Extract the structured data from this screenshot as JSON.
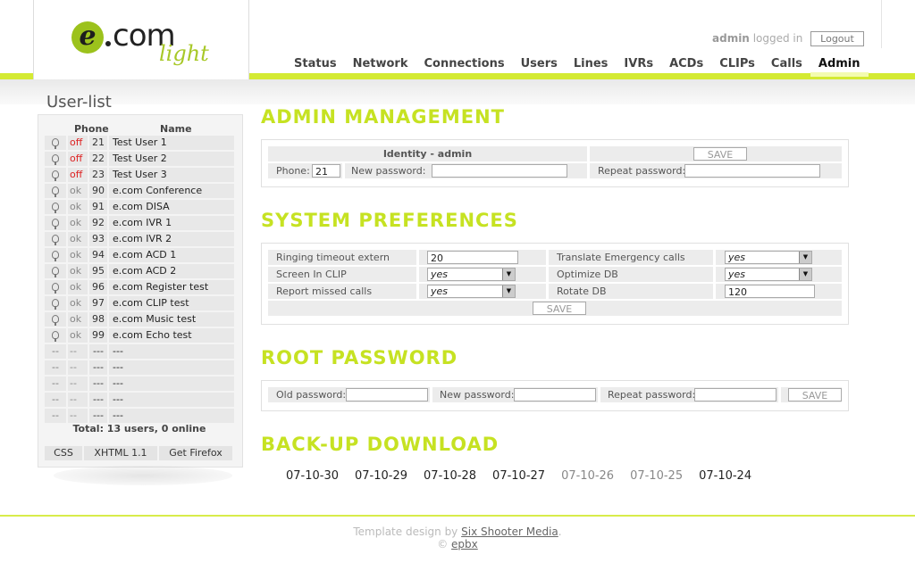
{
  "brand": {
    "logo_e": "e",
    "logo_com": "com",
    "logo_light": "light"
  },
  "login": {
    "user": "admin",
    "status": "logged in",
    "logout_label": "Logout"
  },
  "nav": [
    "Status",
    "Network",
    "Connections",
    "Users",
    "Lines",
    "IVRs",
    "ACDs",
    "CLIPs",
    "Calls",
    "Admin"
  ],
  "nav_active": "Admin",
  "sidebar": {
    "title": "User-list",
    "col_phone": "Phone",
    "col_name": "Name",
    "rows": [
      {
        "status": "off",
        "phone": "21",
        "name": "Test User 1"
      },
      {
        "status": "off",
        "phone": "22",
        "name": "Test User 2"
      },
      {
        "status": "off",
        "phone": "23",
        "name": "Test User 3"
      },
      {
        "status": "ok",
        "phone": "90",
        "name": "e.com Conference"
      },
      {
        "status": "ok",
        "phone": "91",
        "name": "e.com DISA"
      },
      {
        "status": "ok",
        "phone": "92",
        "name": "e.com IVR 1"
      },
      {
        "status": "ok",
        "phone": "93",
        "name": "e.com IVR 2"
      },
      {
        "status": "ok",
        "phone": "94",
        "name": "e.com ACD 1"
      },
      {
        "status": "ok",
        "phone": "95",
        "name": "e.com ACD 2"
      },
      {
        "status": "ok",
        "phone": "96",
        "name": "e.com Register test"
      },
      {
        "status": "ok",
        "phone": "97",
        "name": "e.com CLIP test"
      },
      {
        "status": "ok",
        "phone": "98",
        "name": "e.com Music test"
      },
      {
        "status": "ok",
        "phone": "99",
        "name": "e.com Echo test"
      }
    ],
    "empty_row": {
      "c1": "--",
      "c2": "--",
      "c3": "---",
      "c4": "---"
    },
    "empty_count": 5,
    "total": "Total: 13 users, 0 online",
    "footer_links": [
      "CSS",
      "XHTML 1.1",
      "Get Firefox"
    ]
  },
  "admin": {
    "heading": "ADMIN MANAGEMENT",
    "identity": "Identity - admin",
    "save": "SAVE",
    "phone_label": "Phone:",
    "phone_value": "21",
    "new_pw_label": "New password:",
    "repeat_pw_label": "Repeat password:"
  },
  "prefs": {
    "heading": "SYSTEM PREFERENCES",
    "ringing_label": "Ringing timeout extern",
    "ringing_value": "20",
    "screen_clip_label": "Screen In CLIP",
    "screen_clip_value": "yes",
    "report_missed_label": "Report missed calls",
    "report_missed_value": "yes",
    "translate_label": "Translate Emergency calls",
    "translate_value": "yes",
    "optimize_label": "Optimize DB",
    "optimize_value": "yes",
    "rotate_label": "Rotate DB",
    "rotate_value": "120",
    "save": "SAVE"
  },
  "root": {
    "heading": "ROOT PASSWORD",
    "old_label": "Old password:",
    "new_label": "New password:",
    "repeat_label": "Repeat password:",
    "save": "SAVE"
  },
  "backup": {
    "heading": "BACK-UP DOWNLOAD",
    "dates": [
      {
        "label": "07-10-30",
        "dim": false
      },
      {
        "label": "07-10-29",
        "dim": false
      },
      {
        "label": "07-10-28",
        "dim": false
      },
      {
        "label": "07-10-27",
        "dim": false
      },
      {
        "label": "07-10-26",
        "dim": true
      },
      {
        "label": "07-10-25",
        "dim": true
      },
      {
        "label": "07-10-24",
        "dim": false
      }
    ]
  },
  "footer": {
    "design_prefix": "Template design by",
    "design_link": "Six Shooter Media",
    "design_suffix": ".",
    "copyright": "©",
    "copy_link": "epbx"
  },
  "colors": {
    "accent": "#c6e222",
    "line": "#d4ea33",
    "off": "#dd2222"
  }
}
